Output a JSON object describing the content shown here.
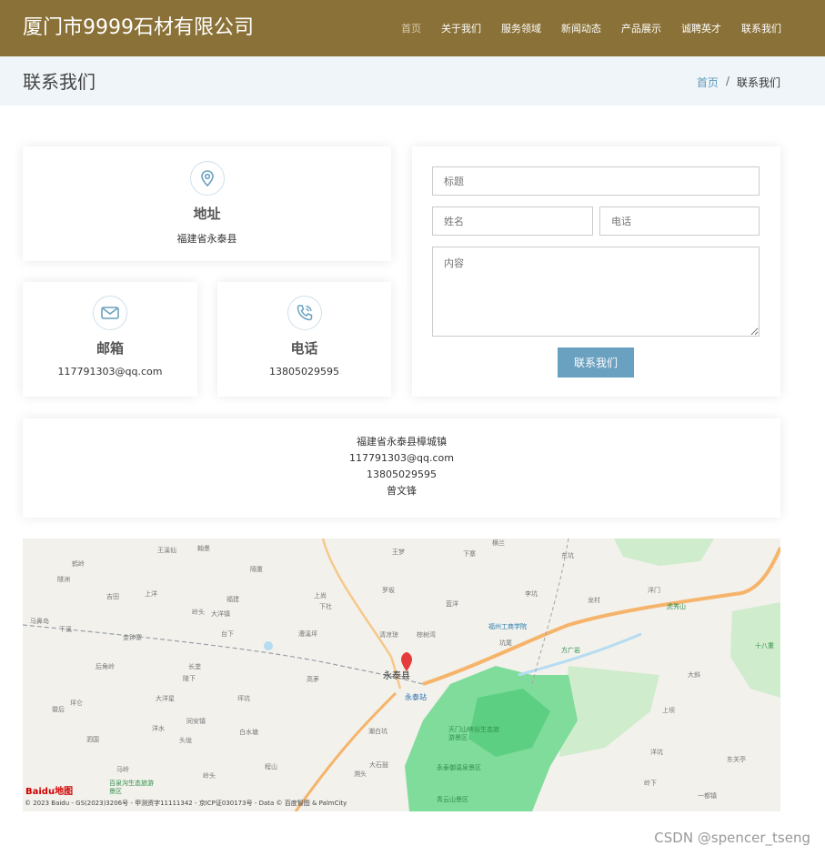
{
  "header": {
    "logo": "厦门市9999石材有限公司",
    "nav": [
      "首页",
      "关于我们",
      "服务领域",
      "新闻动态",
      "产品展示",
      "诚聘英才",
      "联系我们"
    ]
  },
  "titlebar": {
    "title": "联系我们",
    "breadcrumb": {
      "home": "首页",
      "sep": "/",
      "current": "联系我们"
    }
  },
  "address_card": {
    "icon": "location-pin-icon",
    "title": "地址",
    "value": "福建省永泰县"
  },
  "email_card": {
    "icon": "envelope-icon",
    "title": "邮箱",
    "value": "117791303@qq.com"
  },
  "phone_card": {
    "icon": "phone-icon",
    "title": "电话",
    "value": "13805029595"
  },
  "form": {
    "title_placeholder": "标题",
    "name_placeholder": "姓名",
    "phone_placeholder": "电话",
    "content_placeholder": "内容",
    "submit_label": "联系我们"
  },
  "info": {
    "address": "福建省永泰县樟城镇",
    "email": "117791303@qq.com",
    "phone": "13805029595",
    "contact": "曾文锋"
  },
  "map": {
    "center_label": "永泰县",
    "station_label": "永泰站",
    "labels": [
      "王溪仙",
      "翰墨",
      "鹤岭",
      "隔重",
      "王梦",
      "下寨",
      "横兰",
      "东坑",
      "隧洲",
      "吉田",
      "上洋",
      "福建",
      "岭头",
      "大洋镇",
      "上尚",
      "下社",
      "罗坂",
      "蓝洋",
      "李坑",
      "龙村",
      "洋门",
      "虎秀山",
      "马鼻岛",
      "下溪",
      "金钟寨",
      "台下",
      "漕溪坪",
      "清凉琼",
      "棕树湾",
      "福州工商学院",
      "坑尾",
      "方广岩",
      "十八重",
      "后角岭",
      "长垄",
      "高茅",
      "大斜",
      "陵下",
      "大洋星",
      "坪坑",
      "上坝",
      "徽后",
      "坪仑",
      "同安镇",
      "洋水",
      "白水塘",
      "潮白坑",
      "天门山峡谷生态旅游景区",
      "东关亭",
      "泗国",
      "头垅",
      "洋坑",
      "马岭",
      "岭头",
      "程山",
      "大石鼓",
      "永泰御温泉景区",
      "岭下",
      "百泉沟生态旅游景区",
      "溯头",
      "青云山景区",
      "一都镇"
    ],
    "copyright": "© 2023 Baidu - GS(2023)3206号 - 甲测资字11111342 - 京ICP证030173号 - Data © 百度智图 & PalmCity",
    "logo": "Baidu地图"
  },
  "watermark": "CSDN @spencer_tseng",
  "colors": {
    "header": "#8a7137",
    "accent": "#6aa1c0",
    "titlebar": "#eff5f8"
  }
}
